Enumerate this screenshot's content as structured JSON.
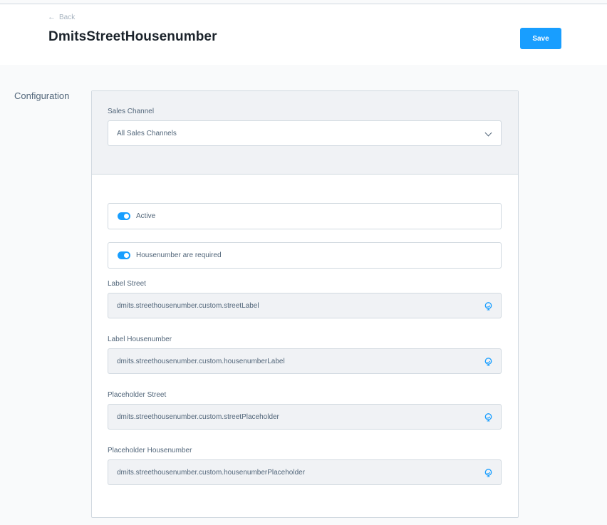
{
  "header": {
    "back_label": "Back",
    "back_icon": "arrow-left-icon",
    "title": "DmitsStreetHousenumber",
    "save_label": "Save"
  },
  "section": {
    "label": "Configuration"
  },
  "sales_channel": {
    "label": "Sales Channel",
    "value": "All Sales Channels",
    "icon": "chevron-down-icon"
  },
  "switches": [
    {
      "label": "Active",
      "checked": true
    },
    {
      "label": "Housenumber are required",
      "checked": true
    }
  ],
  "fields": [
    {
      "label": "Label Street",
      "value": "dmits.streethousenumber.custom.streetLabel",
      "icon": "globe-icon"
    },
    {
      "label": "Label Housenumber",
      "value": "dmits.streethousenumber.custom.housenumberLabel",
      "icon": "globe-icon"
    },
    {
      "label": "Placeholder Street",
      "value": "dmits.streethousenumber.custom.streetPlaceholder",
      "icon": "globe-icon"
    },
    {
      "label": "Placeholder Housenumber",
      "value": "dmits.streethousenumber.custom.housenumberPlaceholder",
      "icon": "globe-icon"
    }
  ],
  "colors": {
    "accent": "#189eff",
    "text": "#52667a",
    "title": "#1b232b",
    "border": "#d1d9e0",
    "muted_bg": "#f0f2f5"
  }
}
